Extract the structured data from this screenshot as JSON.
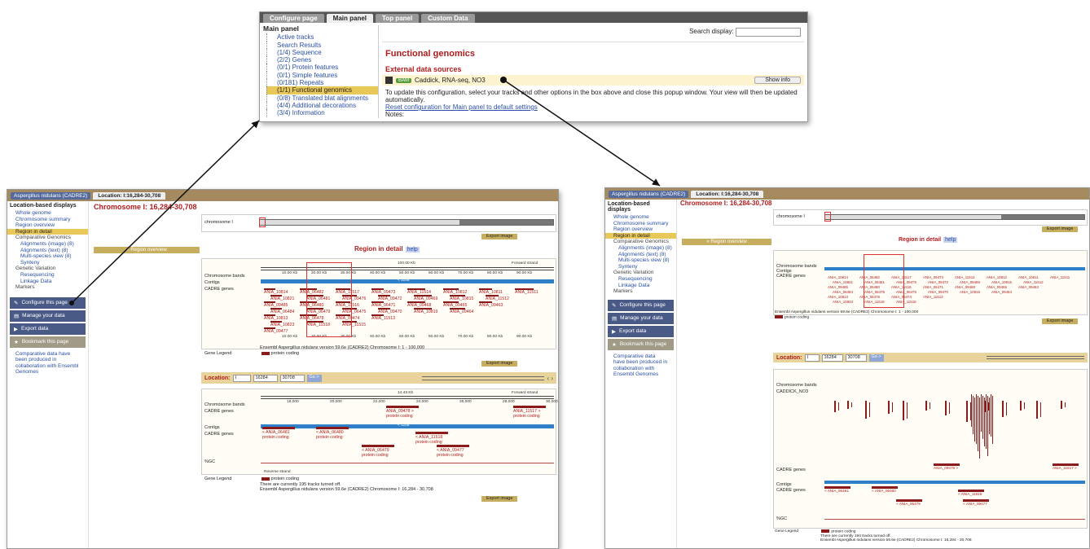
{
  "popup": {
    "tabs": [
      "Configure page",
      "Main panel",
      "Top panel",
      "Custom Data"
    ],
    "active_tab": "Main panel",
    "sidebar_title": "Main panel",
    "sidebar_items": [
      "Active tracks",
      "Search Results",
      "(1/4) Sequence",
      "(2/2) Genes",
      "(0/1) Protein features",
      "(0/1) Simple features",
      "(0/181) Repeats",
      "(1/1) Functional genomics",
      "(0/8) Translated blat alignments",
      "(4/4) Additional decorations",
      "(3/4) Information"
    ],
    "selected_item": "(1/1) Functional genomics",
    "search_label": "Search display:",
    "section_title": "Functional genomics",
    "subsection_title": "External data sources",
    "source_badge": "BAM",
    "source_label": "Caddick, RNA-seq, NO3",
    "show_info": "Show info",
    "note_text": "To update this configuration, select your tracks and other options in the box above and close this popup window. Your view will then be updated automatically.",
    "reset_link": "Reset configuration for Main panel to default settings",
    "notes_label": "Notes:"
  },
  "left": {
    "species": "Aspergillus nidulans (CADRE2)",
    "location_tab": "Location: I:16,284-30,708",
    "sidebar_title": "Location-based displays",
    "items": [
      {
        "label": "Whole genome",
        "sub": false
      },
      {
        "label": "Chromosome summary",
        "sub": false
      },
      {
        "label": "Region overview",
        "sub": false
      },
      {
        "label": "Region in detail",
        "sub": false,
        "sel": true
      },
      {
        "label": "Comparative Genomics",
        "sub": false,
        "plain": true
      },
      {
        "label": "Alignments (image) (8)",
        "sub": true
      },
      {
        "label": "Alignments (text) (8)",
        "sub": true
      },
      {
        "label": "Multi-species view (8)",
        "sub": true
      },
      {
        "label": "Synteny",
        "sub": true
      },
      {
        "label": "Genetic Variation",
        "sub": false,
        "plain": true
      },
      {
        "label": "Resequencing",
        "sub": true
      },
      {
        "label": "Linkage Data",
        "sub": true
      },
      {
        "label": "Markers",
        "sub": false,
        "plain": true
      }
    ],
    "buttons": [
      "Configure this page",
      "Manage your data",
      "Export data",
      "Bookmark this page"
    ],
    "side_note": "Comparative data have been produced in collaboration with Ensembl Genomes",
    "chrom_title": "Chromosome I: 16,284-30,708",
    "chrom_label": "chromosome I",
    "export_label": "Export image",
    "region_overview": "« Region overview",
    "region_detail": "Region in detail",
    "help": "help",
    "track_labels_1": [
      "Chromosome bands",
      "Contigs",
      "CADRE genes"
    ],
    "ruler_1": [
      "10.00 Kb",
      "20.00 Kb",
      "30.00 Kb",
      "40.00 Kb",
      "50.00 Kb",
      "60.00 Kb",
      "70.00 Kb",
      "80.00 Kb",
      "90.00 Kb"
    ],
    "range_label": "100.00 Kb",
    "forward": "Forward strand",
    "contig_1": "< 1108",
    "genes_1": [
      "ANIA_10814",
      "ANIA_06482",
      "ANIA_11517",
      "ANIA_09473",
      "ANIA_11514",
      "ANIA_10812",
      "ANIA_10811",
      "ANIA_11511",
      "ANIA_10821",
      "ANIA_06481",
      "ANIA_09476",
      "ANIA_09472",
      "ANIA_09469",
      "ANIA_10815",
      "ANIA_11512",
      "ANIA_09485",
      "ANIA_06480",
      "ANIA_11516",
      "ANIA_06471",
      "ANIA_09468",
      "ANIA_09465",
      "ANIA_09463",
      "ANIA_06484",
      "ANIA_06479",
      "ANIA_06475",
      "ANIA_09470",
      "ANIA_10819",
      "ANIA_09464",
      "ANIA_10813",
      "ANIA_06478",
      "ANIA_09474",
      "ANIA_11513",
      "ANIA_10823",
      "ANIA_11518",
      "ANIA_11515",
      "ANIA_09477"
    ],
    "gene_legend": "Gene Legend",
    "protein_coding": "protein coding",
    "footer_1": "Ensembl Aspergillus nidulans version 59.6e (CADRE2) Chromosome I: 1 - 100,000",
    "location_label": "Location:",
    "loc_chr": "I",
    "loc_start": "16284",
    "loc_end": "30708",
    "go": "Go >",
    "range_2": "14.43 Kb",
    "ruler_2": [
      "18,000",
      "20,000",
      "22,000",
      "24,000",
      "26,000",
      "28,000",
      "30,000"
    ],
    "contig_2": "< 1108",
    "genes_2": [
      {
        "name": "ANIA_09478 >",
        "type": "protein coding"
      },
      {
        "name": "ANIA_11517 >",
        "type": "protein coding"
      },
      {
        "name": "< ANIA_06481",
        "type": "protein coding"
      },
      {
        "name": "< ANIA_06480",
        "type": "protein coding"
      },
      {
        "name": "< ANIA_11518",
        "type": "protein coding"
      },
      {
        "name": "< ANIA_06479",
        "type": "protein coding"
      },
      {
        "name": "< ANIA_09477",
        "type": "protein coding"
      }
    ],
    "gc_label": "%GC",
    "reverse": "Reverse strand",
    "tracks_off": "There are currently 195 tracks turned off.",
    "footer_2": "Ensembl Aspergillus nidulans version 59.6e (CADRE2) Chromosome I: 16,284 - 30,708"
  },
  "right": {
    "species": "Aspergillus nidulans (CADRE2)",
    "location_tab": "Location: I:16,284-30,708",
    "track_bam": "CADDICK_NO3",
    "tracks_off": "There are currently 194 tracks turned off.",
    "footer_1": "Ensembl Aspergillus nidulans version 59.6e (CADRE2) Chromosome I: 1 - 100,000",
    "footer_2": "Ensembl Aspergillus nidulans version 59.6e (CADRE2) Chromosome I: 16,284 - 30,708"
  },
  "colors": {
    "accent": "#b01c1c",
    "link": "#2a4fa8",
    "gold": "#e9c85a",
    "contig": "#2f7fc9",
    "gene": "#8b1a1a"
  }
}
